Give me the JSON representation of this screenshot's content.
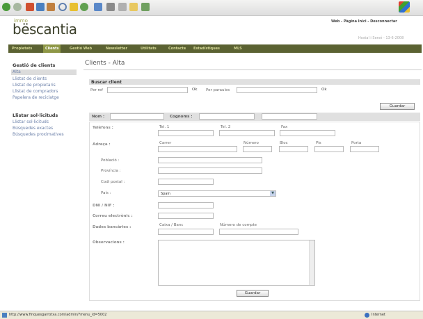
{
  "header": {
    "logo_small": "immo",
    "logo_main": "bëscantia",
    "top_links": "Web  -  Pàgina Inici  -  Desconnectar",
    "user_line": "Hostal i Sersé  -  13-6-2008"
  },
  "nav": [
    "Propietats",
    "Clients",
    "Gestió Web",
    "Newsletter",
    "Utilitats",
    "Contacte",
    "Estadístiques",
    "MLS"
  ],
  "sidebar": {
    "heading1": "Gestió de clients",
    "items1": [
      "Alta",
      "Llistat de clients",
      "Llistat de propietaris",
      "Llistat de compradors",
      "Papelera de reciclatge"
    ],
    "heading2": "Llistar sol·licituds",
    "items2": [
      "Llistar sol·licituds",
      "Búsquedes exactes",
      "Búsquedes proximatives"
    ]
  },
  "page_title": "Clients - Alta",
  "search": {
    "title": "Buscar client",
    "by_ref": "Per ref",
    "ok": "Ok",
    "by_words": "Per paraules"
  },
  "form": {
    "save": "Guardar",
    "name": "Nom :",
    "surname": "Cognoms :",
    "phone": "Telèfons :",
    "tel1": "Tel. 1",
    "tel2": "Tel. 2",
    "fax": "Fax",
    "address": "Adreça :",
    "street": "Carrer",
    "number": "Número",
    "block": "Bloc",
    "floor": "Pis",
    "door": "Porta",
    "town": "Població :",
    "province": "Província :",
    "postcode": "Codi postal :",
    "country": "País :",
    "country_value": "Spain",
    "dni": "DNI / NIF :",
    "email": "Correu electrònic :",
    "bank": "Dades bancàries :",
    "bank_entity": "Caixa / Banc",
    "account": "Número de compte",
    "notes": "Observacions :"
  },
  "status": {
    "url": "http://www.finquesgarrotxa.com/admin/?menu_id=5002",
    "zone": "Internet"
  }
}
